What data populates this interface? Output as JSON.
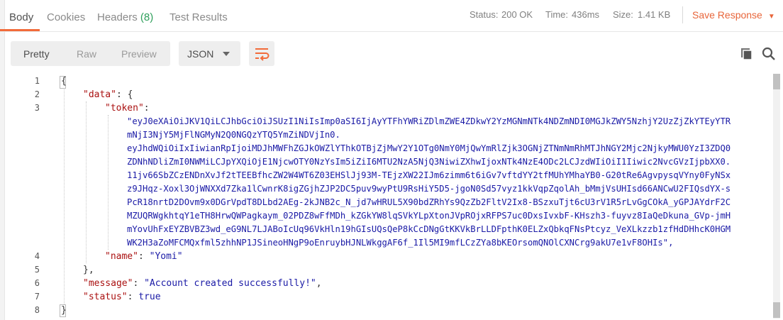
{
  "tabs": [
    {
      "label": "Body"
    },
    {
      "label": "Cookies"
    },
    {
      "label": "Headers",
      "count": "(8)"
    },
    {
      "label": "Test Results"
    }
  ],
  "status": {
    "status_label": "Status:",
    "status_value": "200 OK",
    "time_label": "Time:",
    "time_value": "436ms",
    "size_label": "Size:",
    "size_value": "1.41 KB"
  },
  "save_response": {
    "label": "Save Response"
  },
  "toolbar": {
    "views": [
      "Pretty",
      "Raw",
      "Preview"
    ],
    "format": "JSON",
    "icons": [
      "wrap-lines-icon",
      "copy-icon",
      "search-icon"
    ]
  },
  "colors": {
    "accent": "#f26b3a",
    "success": "#2e9f5b",
    "key": "#aa1111",
    "string": "#1a1aa6"
  },
  "code": {
    "line_numbers": [
      "1",
      "2",
      "3",
      "4",
      "5",
      "6",
      "7",
      "8"
    ],
    "l1": "{",
    "l2_key": "\"data\"",
    "l2_rest": ": {",
    "l3_key": "\"token\"",
    "l3_rest": ":",
    "token_lines": [
      "\"eyJ0eXAiOiJKV1QiLCJhbGciOiJSUzI1NiIsImp0aSI6IjAyYTFhYWRiZDlmZWE4ZDkwY2YzMGNmNTk4NDZmNDI0MGJkZWY5NzhjY2UzZjZkYTEyYTR",
      "mNjI3NjY5MjFlNGMyN2Q0NGQzYTQ5YmZiNDVjIn0.",
      "eyJhdWQiOiIxIiwianRpIjoiMDJhMWFhZGJkOWZlYThkOTBjZjMwY2Y1OTg0NmY0MjQwYmRlZjk3OGNjZTNmNmRhMTJhNGY2Mjc2NjkyMWU0YzI3ZDQ0",
      "ZDNhNDliZmI0NWMiLCJpYXQiOjE1NjcwOTY0NzYsIm5iZiI6MTU2NzA5NjQ3NiwiZXhwIjoxNTk4NzE4ODc2LCJzdWIiOiI1Iiwic2NvcGVzIjpbXX0.",
      "11jv66SbZCzENDnXvJf2tTEEBfhcZW2W4WT6Z03EHSlJj93M-TEjzXW22IJm6zimm6t6iGv7vftdYY2tfMUhYMhaYB0-G20tRe6AgvpysqVYny0FyNSx",
      "z9JHqz-Xoxl3OjWNXXd7Zka1lCwnrK8igZGjhZJP2DC5puv9wyPtU9RsHiY5D5-jgoN0Sd57vyz1kkVqpZqolAh_bMmjVsUHIsd66ANCwU2FIQsdYX-s",
      "PcR18nrtD2DOvm9x0DGrVpdT8DLbd2AEg-2kJNB2c_N_jd7wHRUL5X90bdZRhYs9QzZb2FltV2Ix8-BSzxuTjt6cU3rV1R5rLvGgCOkA_yGPJAYdrF2C",
      "MZUQRWgkhtqY1eTH8HrwQWPagkaym_02PDZ8wFfMDh_kZGkYW8lqSVkYLpXtonJVpROjxRFPS7uc0DxsIvxbF-KHszh3-fuyvz8IaQeDkuna_GVp-jmH",
      "mYovUhFxEYZBVBZ3wd_eG9NL7LJABoIcUq96VkHln19hGIsUQsQeP8kCcDNgGtKKVkBrLLDFpthK0ELZxQbkqFNsPtcyz_VeXLkzzb1zfHdDHhcK0HGM",
      "WK2H3aZoMFCMQxfml5zhhNP1JSineoHNgP9oEnruybHJNLWkggAF6f_1Il5MI9mfLCzZYa8bKEOrsomQNOlCXNCrg9akU7e1vF8OHIs\","
    ],
    "l4_key": "\"name\"",
    "l4_sep": ": ",
    "l4_val": "\"Yomi\"",
    "l5": "},",
    "l6_key": "\"message\"",
    "l6_sep": ": ",
    "l6_val": "\"Account created successfully!\"",
    "l6_end": ",",
    "l7_key": "\"status\"",
    "l7_sep": ": ",
    "l7_val": "true",
    "l8": "}"
  }
}
